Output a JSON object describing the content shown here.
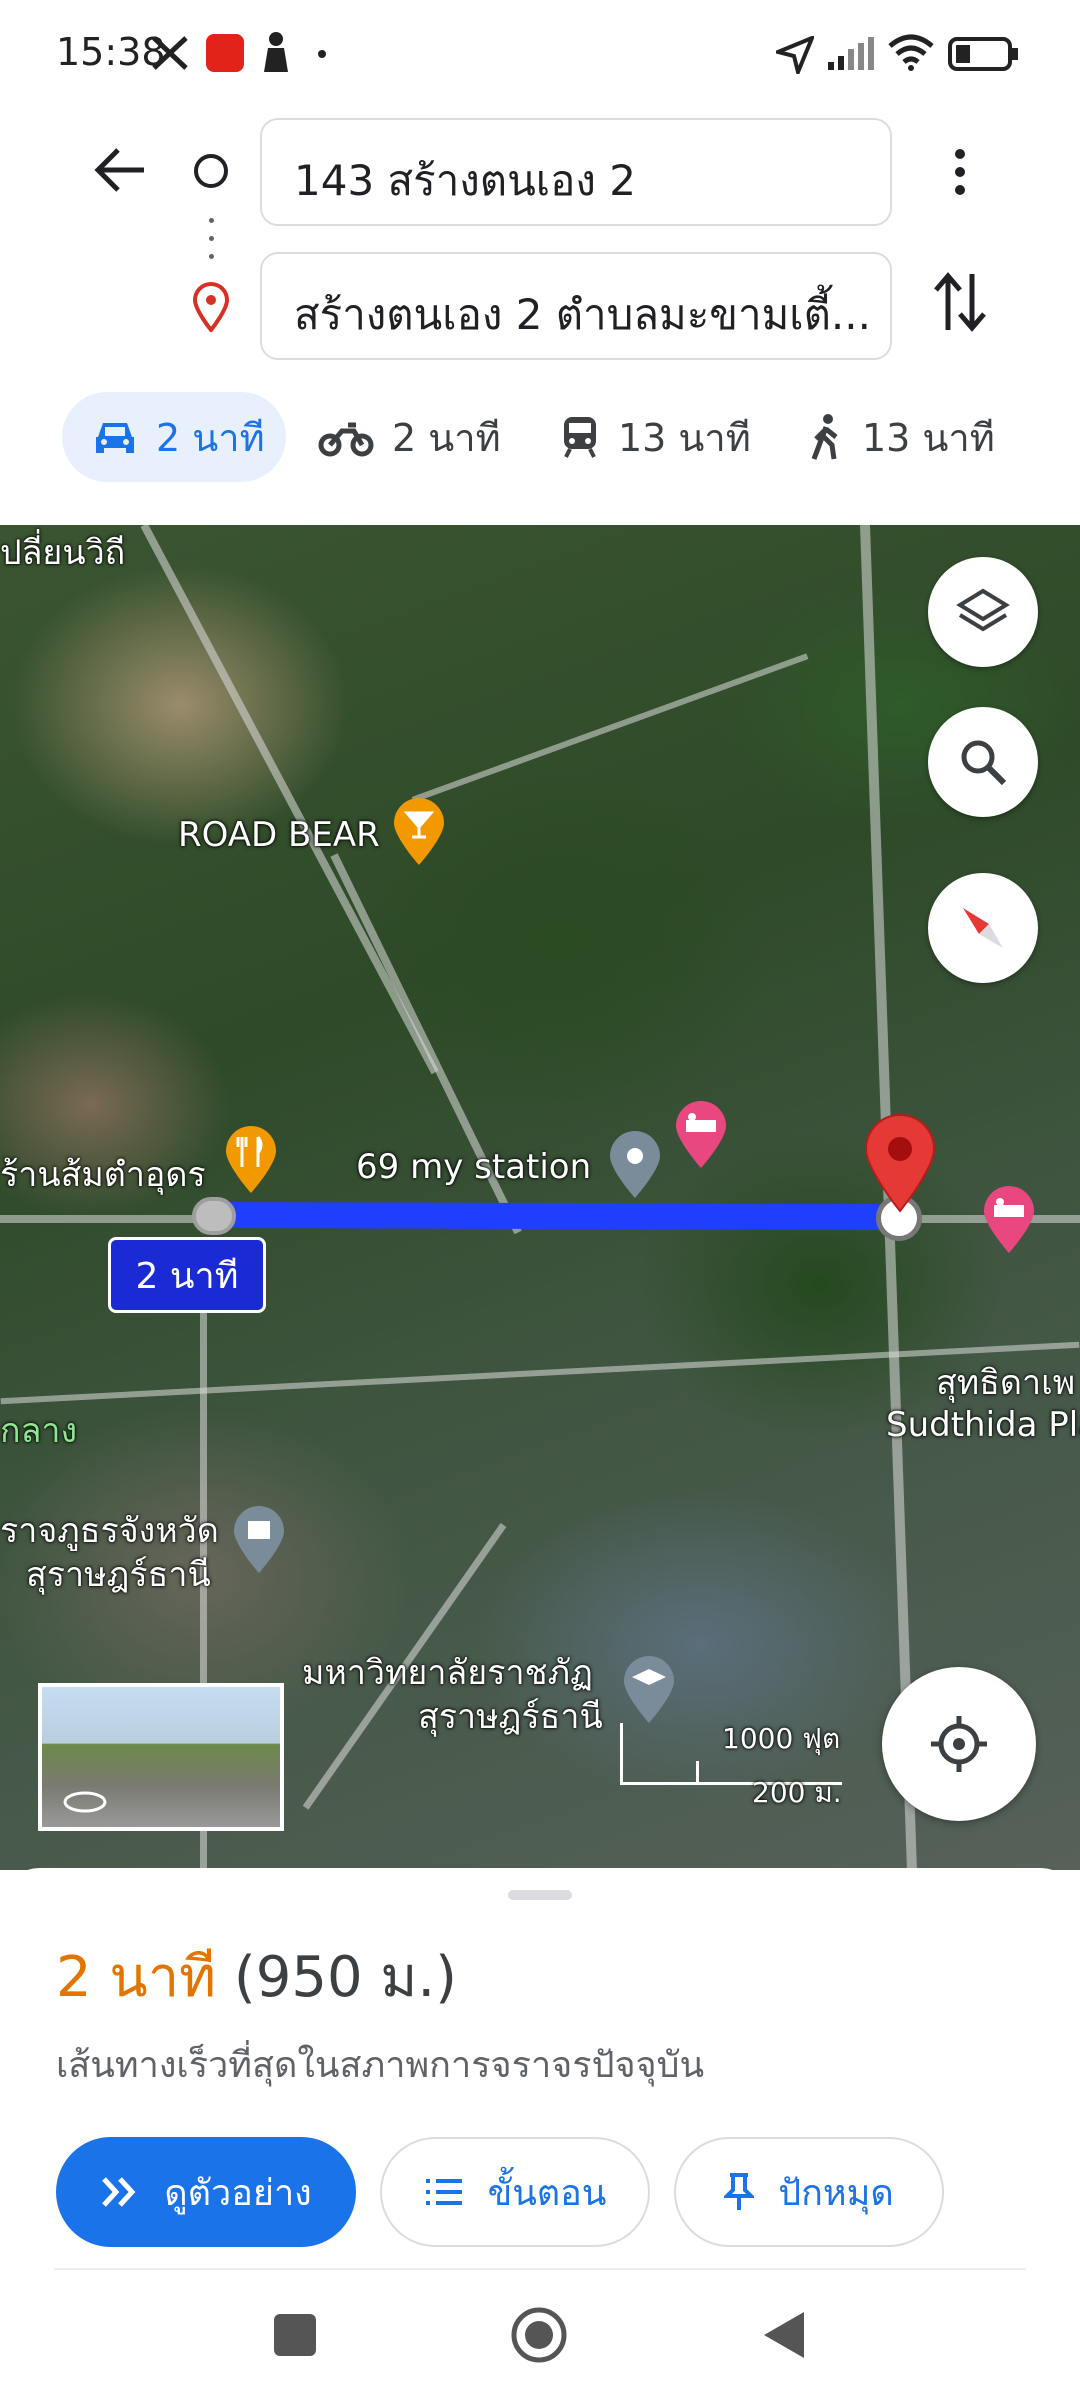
{
  "status_bar": {
    "time": "15:38",
    "icons": [
      "x-icon",
      "lazada-icon",
      "person-icon",
      "dot-icon",
      "location-arrow-icon",
      "signal-icon",
      "wifi-icon",
      "battery-icon"
    ]
  },
  "directions": {
    "origin": "143 สร้างตนเอง 2",
    "destination": "สร้างตนเอง 2 ตำบลมะขามเตี้...",
    "modes": [
      {
        "name": "car",
        "label": "2 นาที",
        "active": true
      },
      {
        "name": "motorcycle",
        "label": "2 นาที",
        "active": false
      },
      {
        "name": "transit",
        "label": "13 นาที",
        "active": false
      },
      {
        "name": "walk",
        "label": "13 นาที",
        "active": false
      }
    ]
  },
  "map": {
    "labels": {
      "road_bear": "ROAD BEAR",
      "som_tam": "ร้านส้มตำอุดร",
      "my_station": "69 my station",
      "route_time": "2 นาที",
      "sudthida_th": "สุทธิดาเพ",
      "sudthida_en": "Sudthida Pla",
      "top_left": "ปลี่ยนวิถี",
      "green_left": "กลาง",
      "office_1": "ราจภูธรจังหวัด",
      "office_2": "สุราษฎร์ธานี",
      "uni_1": "มหาวิทยาลัยราชภัฏ",
      "uni_2": "สุราษฎร์ธานี",
      "scale_ft": "1000 ฟุต",
      "scale_m": "200 ม."
    },
    "route_color": "#1f3fff",
    "pin_color": "#e53935"
  },
  "summary": {
    "time": "2 นาที",
    "distance": "(950 ม.)",
    "note": "เส้นทางเร็วที่สุดในสภาพการจราจรปัจจุบัน",
    "time_color": "#e37400"
  },
  "actions": {
    "preview": "ดูตัวอย่าง",
    "steps": "ขั้นตอน",
    "pin": "ปักหมุด"
  }
}
